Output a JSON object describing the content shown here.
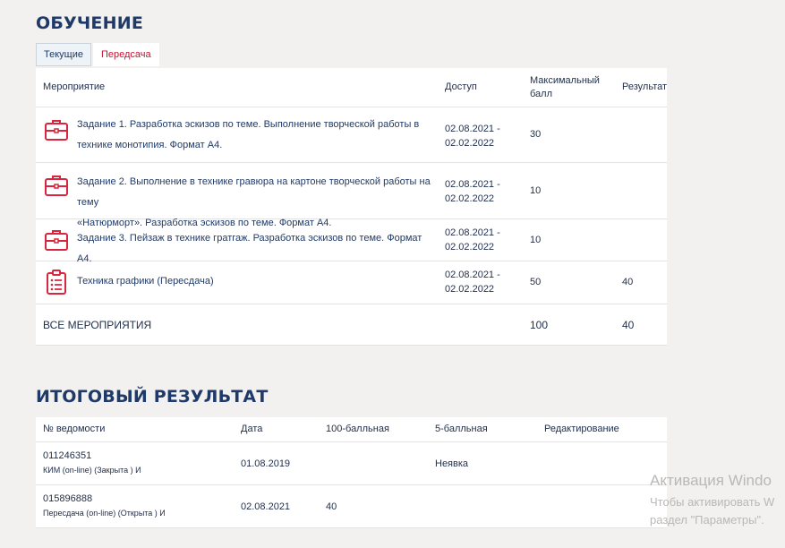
{
  "learning": {
    "title": "ОБУЧЕНИЕ",
    "tabs": [
      {
        "label": "Текущие",
        "active": true
      },
      {
        "label": "Передсача",
        "active": false
      }
    ],
    "columns": {
      "event": "Мероприятие",
      "access": "Доступ",
      "max_score_line1": "Максимальный",
      "max_score_line2": "балл",
      "result": "Результат"
    },
    "rows": [
      {
        "icon": "briefcase-icon",
        "title_line1": "Задание 1. Разработка эскизов по теме. Выполнение творческой работы в",
        "title_line2": "технике монотипия. Формат А4.",
        "date_from": "02.08.2021 -",
        "date_to": "02.02.2022",
        "max": "30",
        "result": ""
      },
      {
        "icon": "briefcase-icon",
        "title_line1": "Задание 2. Выполнение в технике гравюра на картоне творческой работы на тему",
        "title_line2": "«Натюрморт». Разработка эскизов по теме. Формат А4.",
        "date_from": "02.08.2021 -",
        "date_to": "02.02.2022",
        "max": "10",
        "result": ""
      },
      {
        "icon": "briefcase-icon",
        "title_line1": "Задание 3. Пейзаж в технике гратгаж. Разработка эскизов по теме. Формат А4.",
        "title_line2": "",
        "date_from": "02.08.2021 -",
        "date_to": "02.02.2022",
        "max": "10",
        "result": ""
      },
      {
        "icon": "clipboard-checklist-icon",
        "title_line1": "Техника графики (Пересдача)",
        "title_line2": "",
        "date_from": "02.08.2021 -",
        "date_to": "02.02.2022",
        "max": "50",
        "result": "40"
      }
    ],
    "total": {
      "label": "ВСЕ МЕРОПРИЯТИЯ",
      "max": "100",
      "result": "40"
    }
  },
  "final_result": {
    "title": "ИТОГОВЫЙ РЕЗУЛЬТАТ",
    "columns": {
      "sheet_no": "№ ведомости",
      "date": "Дата",
      "score100": "100-балльная",
      "score5": "5-балльная",
      "edit": "Редактирование"
    },
    "rows": [
      {
        "number": "011246351",
        "type": "КИМ (on-line) (Закрыта ) И",
        "date": "01.08.2019",
        "score100": "",
        "score5": "Неявка"
      },
      {
        "number": "015896888",
        "type": "Пересдача (on-line) (Открыта ) И",
        "date": "02.08.2021",
        "score100": "40",
        "score5": ""
      }
    ]
  },
  "watermark": {
    "line1": "Активация Windo",
    "line2": "Чтобы активировать W",
    "line3": "раздел \"Параметры\"."
  },
  "colors": {
    "heading": "#1f3a68",
    "accent_red": "#c8102e",
    "background": "#f2f1ef"
  }
}
